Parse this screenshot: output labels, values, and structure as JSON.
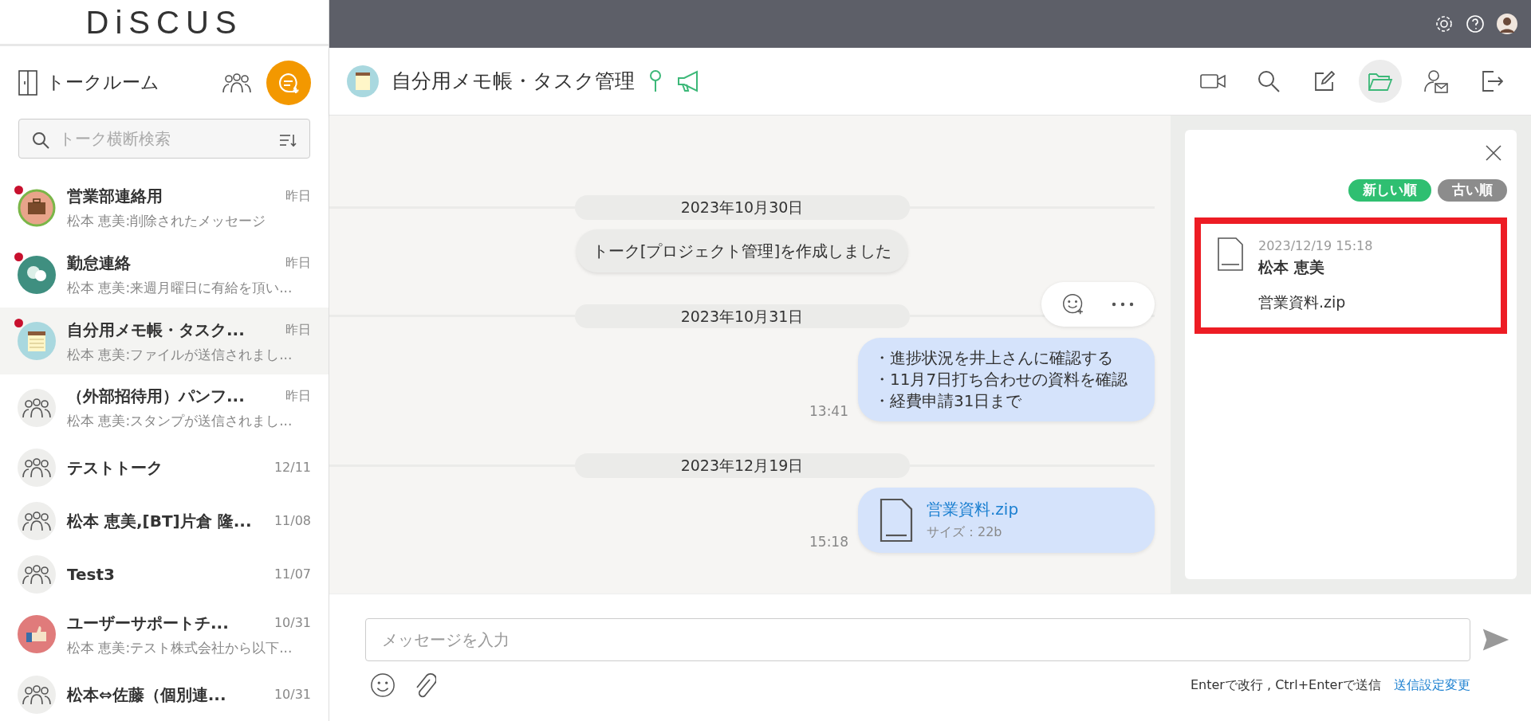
{
  "logo": "DiSCUS",
  "sidebar": {
    "title": "トークルーム",
    "search": {
      "placeholder": "トーク横断検索"
    },
    "items": [
      {
        "name": "営業部連絡用",
        "date": "昨日",
        "preview": "松本 恵美:削除されたメッセージ",
        "kind": "briefcase",
        "unread": true,
        "selected": false
      },
      {
        "name": "勤怠連絡",
        "date": "昨日",
        "preview": "松本 恵美:来週月曜日に有給を頂い...",
        "kind": "chat",
        "unread": true,
        "selected": false
      },
      {
        "name": "自分用メモ帳・タスク...",
        "date": "昨日",
        "preview": "松本 恵美:ファイルが送信されまし...",
        "kind": "notepad",
        "unread": true,
        "selected": true
      },
      {
        "name": "（外部招待用）パンフ...",
        "date": "昨日",
        "preview": "松本 恵美:スタンプが送信されまし...",
        "kind": "group",
        "unread": false,
        "selected": false
      },
      {
        "name": "テストトーク",
        "date": "12/11",
        "kind": "group",
        "unread": false,
        "selected": false
      },
      {
        "name": "松本 恵美,[BT]片倉 隆...",
        "date": "11/08",
        "kind": "group",
        "unread": false,
        "selected": false
      },
      {
        "name": "Test3",
        "date": "11/07",
        "kind": "group",
        "unread": false,
        "selected": false
      },
      {
        "name": "ユーザーサポートチ...",
        "date": "10/31",
        "preview": "松本 恵美:テスト株式会社から以下...",
        "kind": "thumbs",
        "unread": false,
        "selected": false
      },
      {
        "name": "松本⇔佐藤（個別連...",
        "date": "10/31",
        "kind": "group",
        "unread": false,
        "selected": false
      }
    ]
  },
  "chat": {
    "title": "自分用メモ帳・タスク管理",
    "files_open": true,
    "messages": [
      {
        "kind": "date",
        "text": "2023年10月30日"
      },
      {
        "kind": "system",
        "text": "トーク[プロジェクト管理]を作成しました"
      },
      {
        "kind": "date",
        "text": "2023年10月31日"
      },
      {
        "kind": "text",
        "hovered": true,
        "time": "13:41",
        "lines": [
          "・進捗状況を井上さんに確認する",
          "・11月7日打ち合わせの資料を確認",
          "・経費申請31日まで"
        ]
      },
      {
        "kind": "date",
        "text": "2023年12月19日"
      },
      {
        "kind": "file",
        "time": "15:18",
        "name": "営業資料.zip",
        "size": "サイズ：22b"
      }
    ]
  },
  "file_panel": {
    "sort": [
      {
        "label": "新しい順",
        "selected": true
      },
      {
        "label": "古い順",
        "selected": false
      }
    ],
    "files": [
      {
        "datetime": "2023/12/19 15:18",
        "sender": "松本 恵美",
        "name": "営業資料.zip",
        "highlighted": true
      }
    ]
  },
  "composer": {
    "placeholder": "メッセージを入力",
    "hint": "Enterで改行 , Ctrl+Enterで送信",
    "settings_link": "送信設定変更"
  }
}
